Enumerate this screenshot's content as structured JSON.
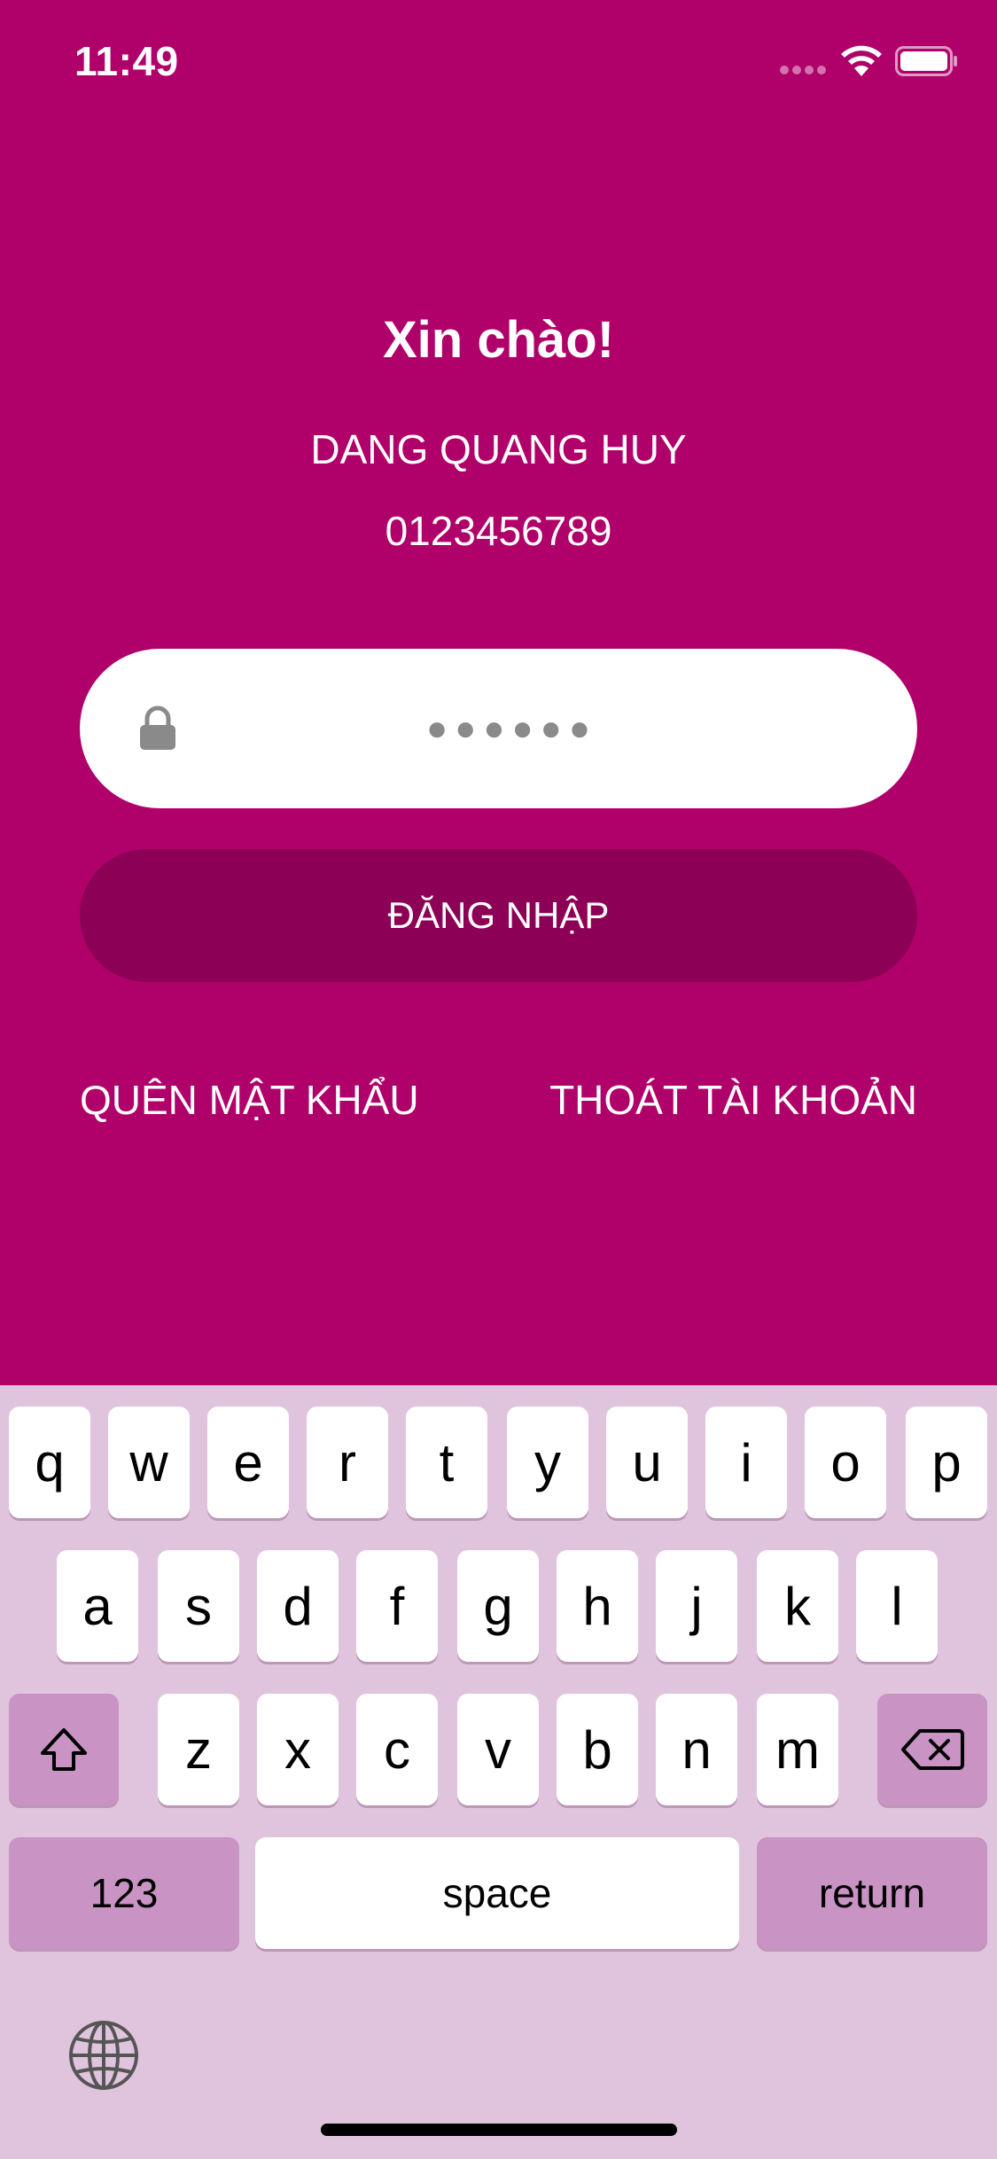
{
  "status_bar": {
    "time": "11:49"
  },
  "login": {
    "greeting": "Xin chào!",
    "user_name": "DANG QUANG HUY",
    "phone": "0123456789",
    "password_masked": "●●●●●●",
    "login_button": "ĐĂNG NHẬP",
    "forgot_password": "QUÊN MẬT KHẨU",
    "logout": "THOÁT TÀI KHOẢN"
  },
  "keyboard": {
    "row1": [
      "q",
      "w",
      "e",
      "r",
      "t",
      "y",
      "u",
      "i",
      "o",
      "p"
    ],
    "row2": [
      "a",
      "s",
      "d",
      "f",
      "g",
      "h",
      "j",
      "k",
      "l"
    ],
    "row3": [
      "z",
      "x",
      "c",
      "v",
      "b",
      "n",
      "m"
    ],
    "numbers_key": "123",
    "space_key": "space",
    "return_key": "return"
  },
  "colors": {
    "background": "#b0006a",
    "login_button": "#8c0056",
    "keyboard_background": "#e0c4de",
    "special_key": "#c993c3"
  },
  "icons": [
    "wifi-icon",
    "battery-icon",
    "lock-icon",
    "shift-icon",
    "backspace-icon",
    "globe-icon"
  ]
}
